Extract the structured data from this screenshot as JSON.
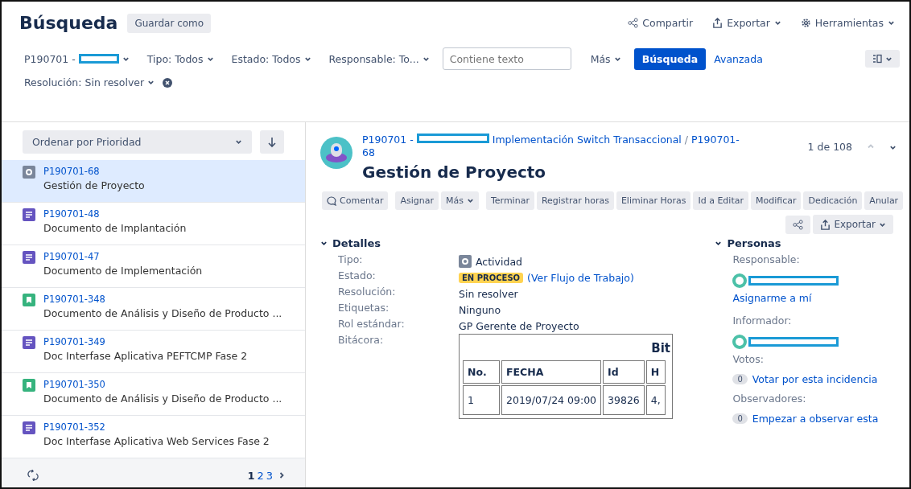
{
  "header": {
    "title": "Búsqueda",
    "save_as": "Guardar como",
    "actions": [
      {
        "kind": "share",
        "label": "Compartir"
      },
      {
        "kind": "export",
        "label": "Exportar"
      },
      {
        "kind": "tools",
        "label": "Herramientas"
      }
    ]
  },
  "filters": {
    "project": "P190701 -",
    "tipo": "Tipo: Todos",
    "estado": "Estado: Todos",
    "responsable": "Responsable: To...",
    "search": {
      "placeholder": "Contiene texto"
    },
    "more": "Más",
    "search_button": "Búsqueda",
    "advanced": "Avanzada",
    "resolution": "Resolución: Sin resolver"
  },
  "sidebar": {
    "sort": "Ordenar por Prioridad",
    "items": [
      {
        "key": "P190701-68",
        "summary": "Gestión de Proyecto",
        "kind": "activity",
        "selected": true
      },
      {
        "key": "P190701-48",
        "summary": "Documento de Implantación",
        "kind": "document",
        "selected": false
      },
      {
        "key": "P190701-47",
        "summary": "Documento de Implementación",
        "kind": "document",
        "selected": false
      },
      {
        "key": "P190701-348",
        "summary": "Documento de Análisis y Diseño de Producto ...",
        "kind": "story",
        "selected": false
      },
      {
        "key": "P190701-349",
        "summary": "Doc Interfase Aplicativa PEFTCMP Fase 2",
        "kind": "document",
        "selected": false
      },
      {
        "key": "P190701-350",
        "summary": "Documento de Análisis y Diseño de Producto ...",
        "kind": "story",
        "selected": false
      },
      {
        "key": "P190701-352",
        "summary": "Doc Interfase Aplicativa Web Services Fase 2",
        "kind": "document",
        "selected": false
      }
    ],
    "pages": [
      {
        "label": "1",
        "selected": true
      },
      {
        "label": "2",
        "selected": false
      },
      {
        "label": "3",
        "selected": false
      }
    ]
  },
  "issue": {
    "breadcrumb": {
      "project": "P190701 -",
      "epic": "Implementación Switch Transaccional",
      "separator": "/",
      "key": "P190701-68"
    },
    "counter": "1 de 108",
    "title": "Gestión de Proyecto",
    "actions": [
      {
        "label": "Comentar",
        "kind": "comment"
      },
      {
        "label": "Asignar",
        "kind": "plain"
      },
      {
        "label": "Más",
        "kind": "menu"
      },
      {
        "label": "Terminar",
        "kind": "plain"
      },
      {
        "label": "Registrar horas",
        "kind": "plain"
      },
      {
        "label": "Eliminar Horas",
        "kind": "plain"
      },
      {
        "label": "Id a Editar",
        "kind": "plain"
      },
      {
        "label": "Modificar",
        "kind": "plain"
      },
      {
        "label": "Dedicación",
        "kind": "plain"
      },
      {
        "label": "Anular",
        "kind": "plain"
      }
    ],
    "export": "Exportar",
    "details": {
      "title": "Detalles",
      "expanded": true,
      "fields": [
        {
          "label": "Tipo:",
          "value": "Actividad",
          "kind": "type"
        },
        {
          "label": "Estado:",
          "value": "EN PROCESO",
          "link": "(Ver Flujo de Trabajo)",
          "kind": "status"
        },
        {
          "label": "Resolución:",
          "value": "Sin resolver",
          "kind": "text"
        },
        {
          "label": "Etiquetas:",
          "value": "Ninguno",
          "kind": "text"
        },
        {
          "label": "Rol estándar:",
          "value": "GP Gerente de Proyecto",
          "kind": "text"
        },
        {
          "label": "Bitácora:",
          "kind": "table"
        }
      ]
    },
    "log_table": {
      "title": "Bit",
      "columns": [
        "No.",
        "FECHA",
        "Id",
        "H"
      ],
      "rows": [
        [
          "1",
          "2019/07/24 09:00",
          "39826",
          "4,"
        ]
      ]
    },
    "people": {
      "title": "Personas",
      "expanded": true,
      "responsable_label": "Responsable:",
      "assign_me": "Asignarme a mí",
      "reporter_label": "Informador:",
      "votes_label": "Votos:",
      "votes_count": "0",
      "vote_link": "Votar por esta incidencia",
      "watchers_label": "Observadores:",
      "watchers_count": "0",
      "watch_link": "Empezar a observar esta"
    }
  }
}
